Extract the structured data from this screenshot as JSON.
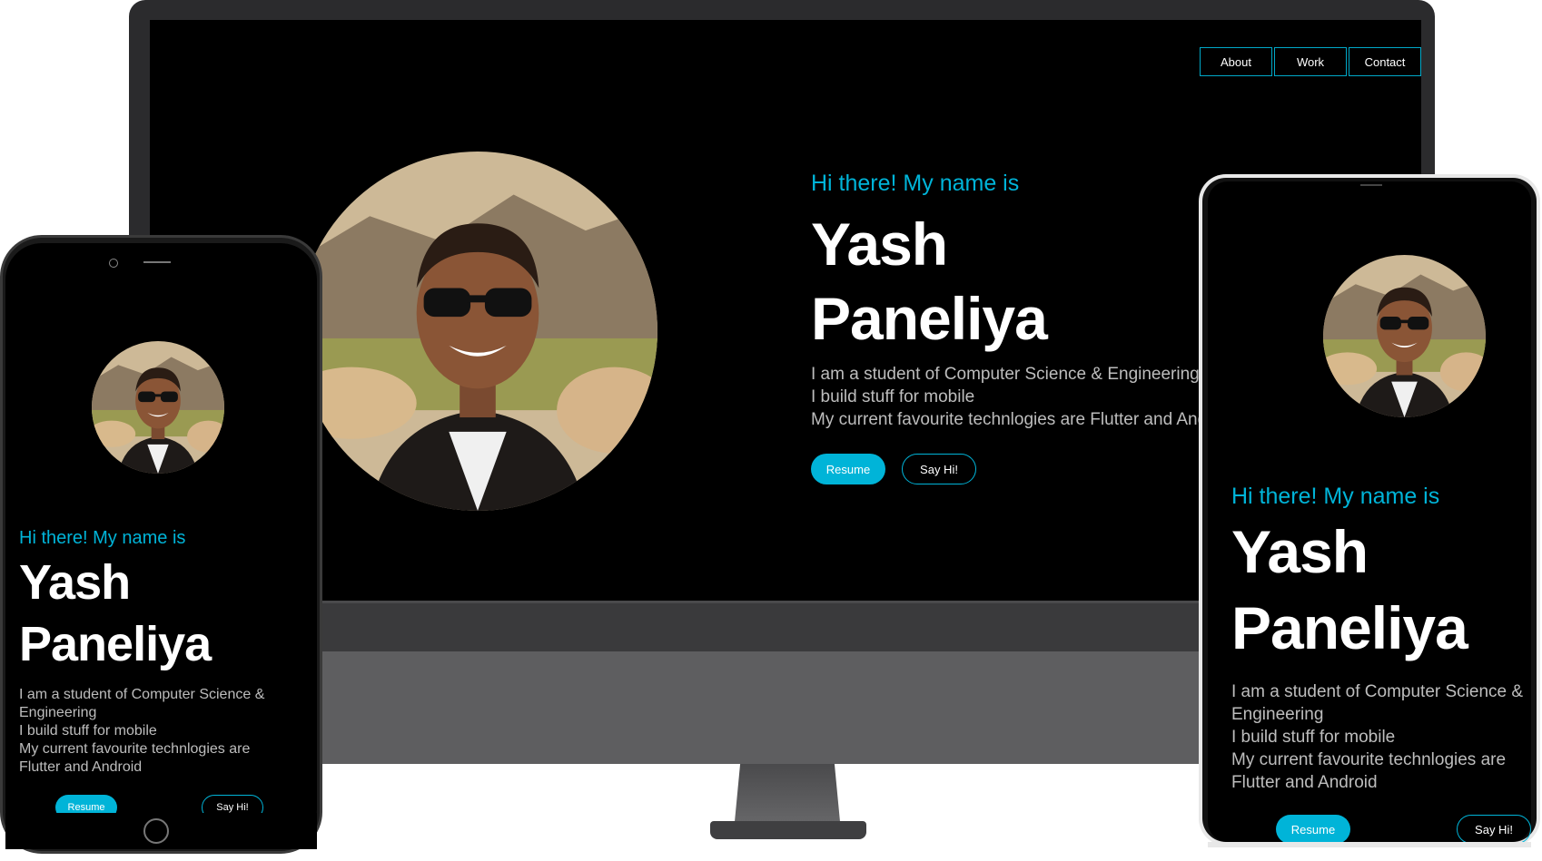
{
  "nav": {
    "about": "About",
    "work": "Work",
    "contact": "Contact"
  },
  "hero": {
    "greeting": "Hi there! My name is",
    "first_name": "Yash",
    "last_name": "Paneliya",
    "bio_line1": "I am a student of Computer Science & Engineering",
    "bio_line2": "I build stuff for mobile",
    "bio_line3": "My current favourite technlogies are Flutter and Android",
    "resume_label": "Resume",
    "sayhi_label": "Say Hi!"
  },
  "left_phone": {
    "bio_line1": "I am a student of Computer Science &",
    "bio_line1b": "Engineering",
    "bio_line2": "I build stuff for mobile",
    "bio_line3": "My current favourite technlogies are",
    "bio_line3b": "Flutter and Android"
  },
  "right_phone": {
    "bio_line1": "I am a student of Computer Science &",
    "bio_line1b": "Engineering",
    "bio_line2": "I build stuff for mobile",
    "bio_line3": "My current favourite technlogies are",
    "bio_line3b": "Flutter and Android"
  },
  "colors": {
    "accent": "#00b4d8",
    "background": "#000000",
    "text": "#ffffff",
    "muted": "#bdbdbd"
  }
}
